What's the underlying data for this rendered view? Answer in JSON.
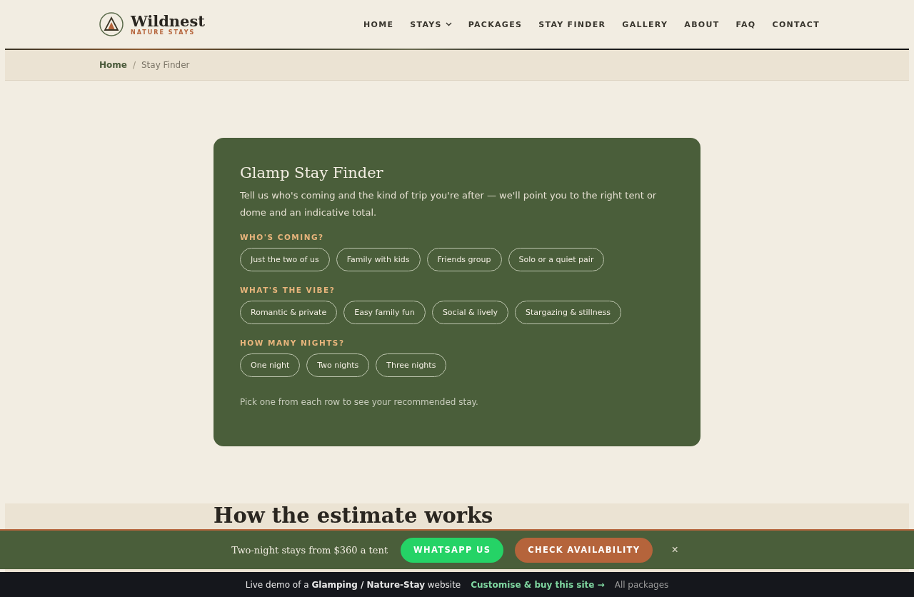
{
  "brand": {
    "name": "Wildnest",
    "tagline": "NATURE STAYS"
  },
  "nav": [
    {
      "label": "HOME",
      "dropdown": false
    },
    {
      "label": "STAYS",
      "dropdown": true
    },
    {
      "label": "PACKAGES",
      "dropdown": false
    },
    {
      "label": "STAY FINDER",
      "dropdown": false
    },
    {
      "label": "GALLERY",
      "dropdown": false
    },
    {
      "label": "ABOUT",
      "dropdown": false
    },
    {
      "label": "FAQ",
      "dropdown": false
    },
    {
      "label": "CONTACT",
      "dropdown": false
    }
  ],
  "breadcrumb": [
    "Home",
    "/",
    "Stay Finder"
  ],
  "finder": {
    "title": "Glamp Stay Finder",
    "intro": "Tell us who's coming and the kind of trip you're after — we'll point you to the right tent or dome and an indicative total.",
    "groups": [
      {
        "label": "WHO'S COMING?",
        "options": [
          {
            "label": "Just the two of us",
            "selected": false
          },
          {
            "label": "Family with kids",
            "selected": false
          },
          {
            "label": "Friends group",
            "selected": false
          },
          {
            "label": "Solo or a quiet pair",
            "selected": false
          }
        ]
      },
      {
        "label": "WHAT'S THE VIBE?",
        "options": [
          {
            "label": "Romantic & private",
            "selected": false
          },
          {
            "label": "Easy family fun",
            "selected": false
          },
          {
            "label": "Social & lively",
            "selected": false
          },
          {
            "label": "Stargazing & stillness",
            "selected": false
          }
        ]
      },
      {
        "label": "HOW MANY NIGHTS?",
        "options": [
          {
            "label": "One night",
            "selected": false
          },
          {
            "label": "Two nights",
            "selected": false
          },
          {
            "label": "Three nights",
            "selected": false
          }
        ]
      }
    ],
    "hint": "Pick one from each row to see your recommended stay."
  },
  "estimate": {
    "heading": "How the estimate works"
  },
  "sticky_bar": {
    "text": "Two-night stays from $360 a tent",
    "whatsapp": "WHATSAPP US",
    "availability": "CHECK AVAILABILITY",
    "close": "×"
  },
  "demo_bar": {
    "prefix": "Live demo of a ",
    "bold": "Glamping / Nature-Stay",
    "suffix": " website",
    "link": "Customise & buy this site →",
    "other": "All packages"
  }
}
